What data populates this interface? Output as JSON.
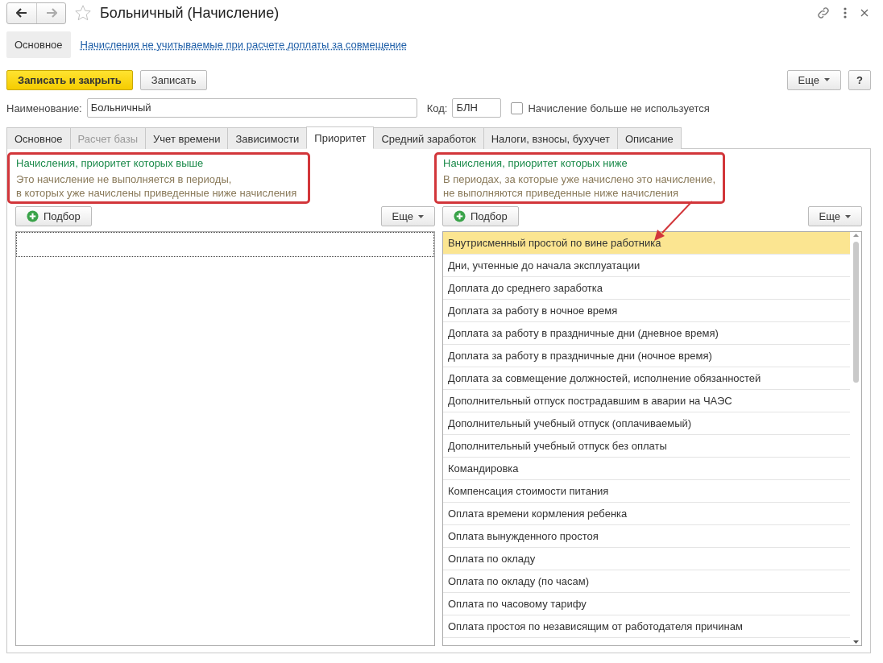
{
  "window": {
    "title": "Больничный (Начисление)"
  },
  "nav_panel": {
    "items": [
      {
        "label": "Основное",
        "selected": true
      },
      {
        "label": "Начисления не учитываемые при расчете доплаты за совмещение",
        "selected": false
      }
    ]
  },
  "toolbar": {
    "primary": "Записать и закрыть",
    "secondary": "Записать",
    "more": "Еще",
    "help": "?"
  },
  "fields": {
    "name_label": "Наименование:",
    "name_value": "Больничный",
    "code_label": "Код:",
    "code_value": "БЛН",
    "unused_label": "Начисление больше не используется",
    "unused_checked": false
  },
  "tabs": [
    {
      "label": "Основное",
      "selected": false,
      "disabled": false
    },
    {
      "label": "Расчет базы",
      "selected": false,
      "disabled": true
    },
    {
      "label": "Учет времени",
      "selected": false,
      "disabled": false
    },
    {
      "label": "Зависимости",
      "selected": false,
      "disabled": false
    },
    {
      "label": "Приоритет",
      "selected": true,
      "disabled": false
    },
    {
      "label": "Средний заработок",
      "selected": false,
      "disabled": false
    },
    {
      "label": "Налоги, взносы, бухучет",
      "selected": false,
      "disabled": false
    },
    {
      "label": "Описание",
      "selected": false,
      "disabled": false
    }
  ],
  "panels": [
    {
      "heading": "Начисления, приоритет которых выше",
      "note_lines": [
        "Это начисление не выполняется в периоды,",
        "в которых уже начислены приведенные ниже начисления"
      ],
      "add_button": "Подбор",
      "more_button": "Еще",
      "arrow": false
    },
    {
      "heading": "Начисления, приоритет которых ниже",
      "note_lines": [
        "В периодах, за которые уже начислено это начисление,",
        "не выполняются приведенные ниже начисления"
      ],
      "add_button": "Подбор",
      "more_button": "Еще",
      "arrow": true,
      "rows": [
        {
          "label": "Внутрисменный простой по вине работника",
          "selected": true
        },
        {
          "label": "Дни, учтенные до начала эксплуатации",
          "selected": false
        },
        {
          "label": "Доплата до среднего заработка",
          "selected": false
        },
        {
          "label": "Доплата за работу в ночное время",
          "selected": false
        },
        {
          "label": "Доплата за работу в праздничные дни (дневное время)",
          "selected": false
        },
        {
          "label": "Доплата за работу в праздничные дни (ночное время)",
          "selected": false
        },
        {
          "label": "Доплата за совмещение должностей, исполнение обязанностей",
          "selected": false
        },
        {
          "label": "Дополнительный отпуск пострадавшим в аварии на ЧАЭС",
          "selected": false
        },
        {
          "label": "Дополнительный учебный отпуск (оплачиваемый)",
          "selected": false
        },
        {
          "label": "Дополнительный учебный отпуск без оплаты",
          "selected": false
        },
        {
          "label": "Командировка",
          "selected": false
        },
        {
          "label": "Компенсация стоимости питания",
          "selected": false
        },
        {
          "label": "Оплата времени кормления ребенка",
          "selected": false
        },
        {
          "label": "Оплата вынужденного простоя",
          "selected": false
        },
        {
          "label": "Оплата по окладу",
          "selected": false
        },
        {
          "label": "Оплата по окладу (по часам)",
          "selected": false
        },
        {
          "label": "Оплата по часовому тарифу",
          "selected": false
        },
        {
          "label": "Оплата простоя по независящим от работодателя причинам",
          "selected": false
        }
      ]
    }
  ]
}
